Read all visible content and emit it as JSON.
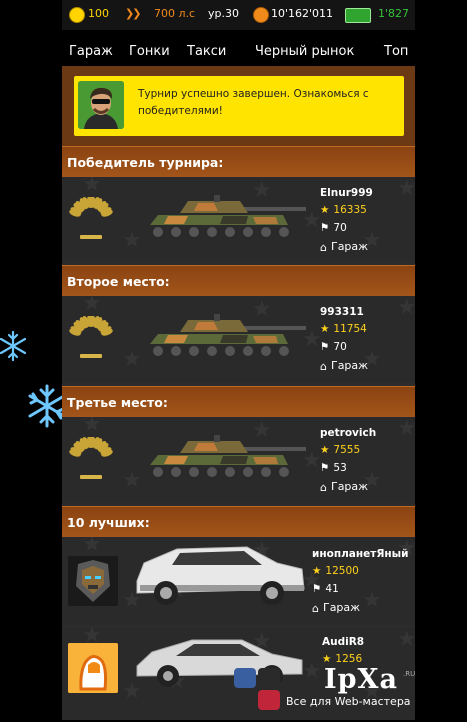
{
  "status": {
    "gold": "100",
    "power": "700 л.с",
    "level": "ур.30",
    "money": "10'162'011",
    "cash": "1'827"
  },
  "nav": [
    "Гараж",
    "Гонки",
    "Такси",
    "Черный рынок",
    "Топ"
  ],
  "notice": "Турнир успешно завершен. Ознакомься с победителями!",
  "sections": {
    "first": "Победитель турнира:",
    "second": "Второе место:",
    "third": "Третье место:",
    "top10": "10 лучших:"
  },
  "winners": [
    {
      "name": "Elnur999",
      "score": "16335",
      "level": "70",
      "garage": "Гараж"
    },
    {
      "name": "993311",
      "score": "11754",
      "level": "70",
      "garage": "Гараж"
    },
    {
      "name": "petrovich",
      "score": "7555",
      "level": "53",
      "garage": "Гараж"
    }
  ],
  "top": [
    {
      "name": "инопланетЯный",
      "score": "12500",
      "level": "41",
      "garage": "Гараж"
    },
    {
      "name": "AudiR8",
      "score": "1256",
      "level": "",
      "garage": ""
    }
  ],
  "watermark": {
    "logo": "IpXa",
    "domain": ".RU",
    "text": "Все для Web-мастера"
  },
  "colors": {
    "accent_bar": "#a4561a",
    "notice_bg": "#ffe400",
    "score": "#ffd21c",
    "money": "#36c43a"
  }
}
